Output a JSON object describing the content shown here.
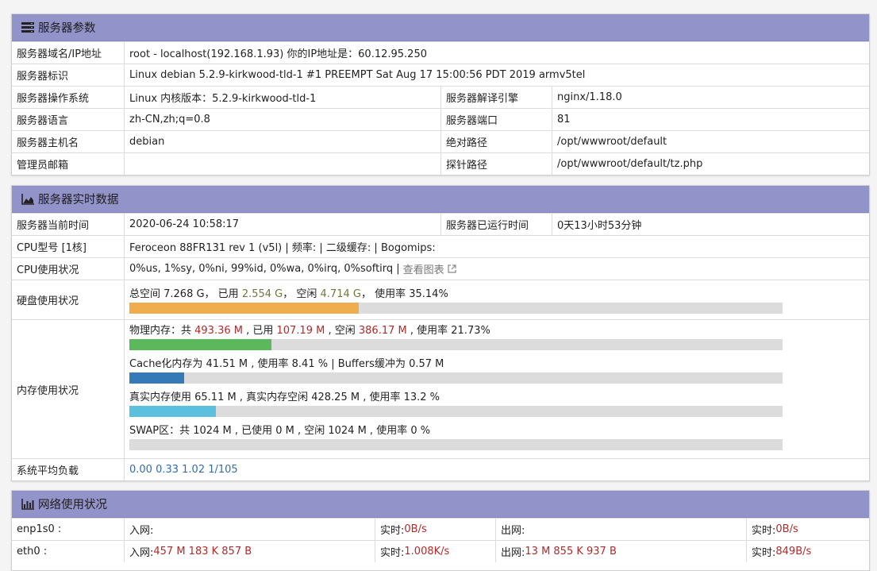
{
  "server_params": {
    "title": "服务器参数",
    "icon": "server-icon",
    "rows": [
      {
        "label": "服务器域名/IP地址",
        "value": "root - localhost(192.168.1.93)  你的IP地址是：60.12.95.250"
      },
      {
        "label": "服务器标识",
        "value": "Linux debian 5.2.9-kirkwood-tld-1 #1 PREEMPT Sat Aug 17 15:00:56 PDT 2019 armv5tel"
      }
    ],
    "pair_rows": [
      {
        "label1": "服务器操作系统",
        "value1": "Linux  内核版本：5.2.9-kirkwood-tld-1",
        "label2": "服务器解译引擎",
        "value2": "nginx/1.18.0"
      },
      {
        "label1": "服务器语言",
        "value1": "zh-CN,zh;q=0.8",
        "label2": "服务器端口",
        "value2": "81"
      },
      {
        "label1": "服务器主机名",
        "value1": "debian",
        "label2": "绝对路径",
        "value2": "/opt/wwwroot/default"
      },
      {
        "label1": "管理员邮箱",
        "value1": "",
        "label2": "探针路径",
        "value2": "/opt/wwwroot/default/tz.php"
      }
    ]
  },
  "realtime": {
    "title": "服务器实时数据",
    "icon": "area-chart-icon",
    "time_label": "服务器当前时间",
    "time_value": "2020-06-24 10:58:17",
    "uptime_label": "服务器已运行时间",
    "uptime_value": "0天13小时53分钟",
    "cpu_model_label": "CPU型号 [1核]",
    "cpu_model_value": "Feroceon 88FR131 rev 1 (v5l) | 频率: | 二级缓存: | Bogomips:",
    "cpu_usage_label": "CPU使用状况",
    "cpu_usage_value": "0%us, 1%sy, 0%ni, 99%id, 0%wa, 0%irq, 0%softirq |",
    "cpu_chart_link": "查看图表",
    "disk_label": "硬盘使用状况",
    "disk": {
      "total_prefix": "总空间 7.268 G，  已用 ",
      "used": "2.554 G",
      "free_prefix": "，  空闲 ",
      "free": "4.714 G",
      "rate_text": "，  使用率 35.14%",
      "percent": 35.14,
      "color": "#f0ad4e"
    },
    "mem_label": "内存使用状况",
    "mem": {
      "physical": {
        "p1": "物理内存：共 ",
        "total": "493.36 M",
        "p2": " , 已用 ",
        "used": "107.19 M",
        "p3": " , 空闲 ",
        "free": "386.17 M",
        "p4": " , 使用率 21.73%",
        "percent": 21.73,
        "color": "#5cb85c"
      },
      "cache": {
        "text": "Cache化内存为 41.51 M , 使用率 8.41 % | Buffers缓冲为 0.57 M",
        "percent": 8.41,
        "color": "#337ab7"
      },
      "real": {
        "text": "真实内存使用 65.11 M , 真实内存空闲 428.25 M , 使用率 13.2 %",
        "percent": 13.2,
        "color": "#5bc0de"
      },
      "swap": {
        "text": "SWAP区：共 1024 M , 已使用 0 M , 空闲 1024 M , 使用率 0 %",
        "percent": 0,
        "color": "#d9534f"
      }
    },
    "load_label": "系统平均负载",
    "load_value": "0.00 0.33 1.02 1/105"
  },
  "network": {
    "title": "网络使用状况",
    "icon": "bar-chart-icon",
    "rows": [
      {
        "iface": "enp1s0 :",
        "in_label": "入网: ",
        "in_value": "",
        "rt_in_label": "实时: ",
        "rt_in_value": "0B/s",
        "out_label": "出网: ",
        "out_value": "",
        "rt_out_label": "实时: ",
        "rt_out_value": "0B/s"
      },
      {
        "iface": "eth0 :",
        "in_label": "入网: ",
        "in_value": "457 M 183 K 857 B",
        "rt_in_label": "实时: ",
        "rt_in_value": "1.008K/s",
        "out_label": "出网: ",
        "out_value": "13 M 855 K 937 B",
        "rt_out_label": "实时: ",
        "rt_out_value": "849B/s"
      }
    ]
  }
}
